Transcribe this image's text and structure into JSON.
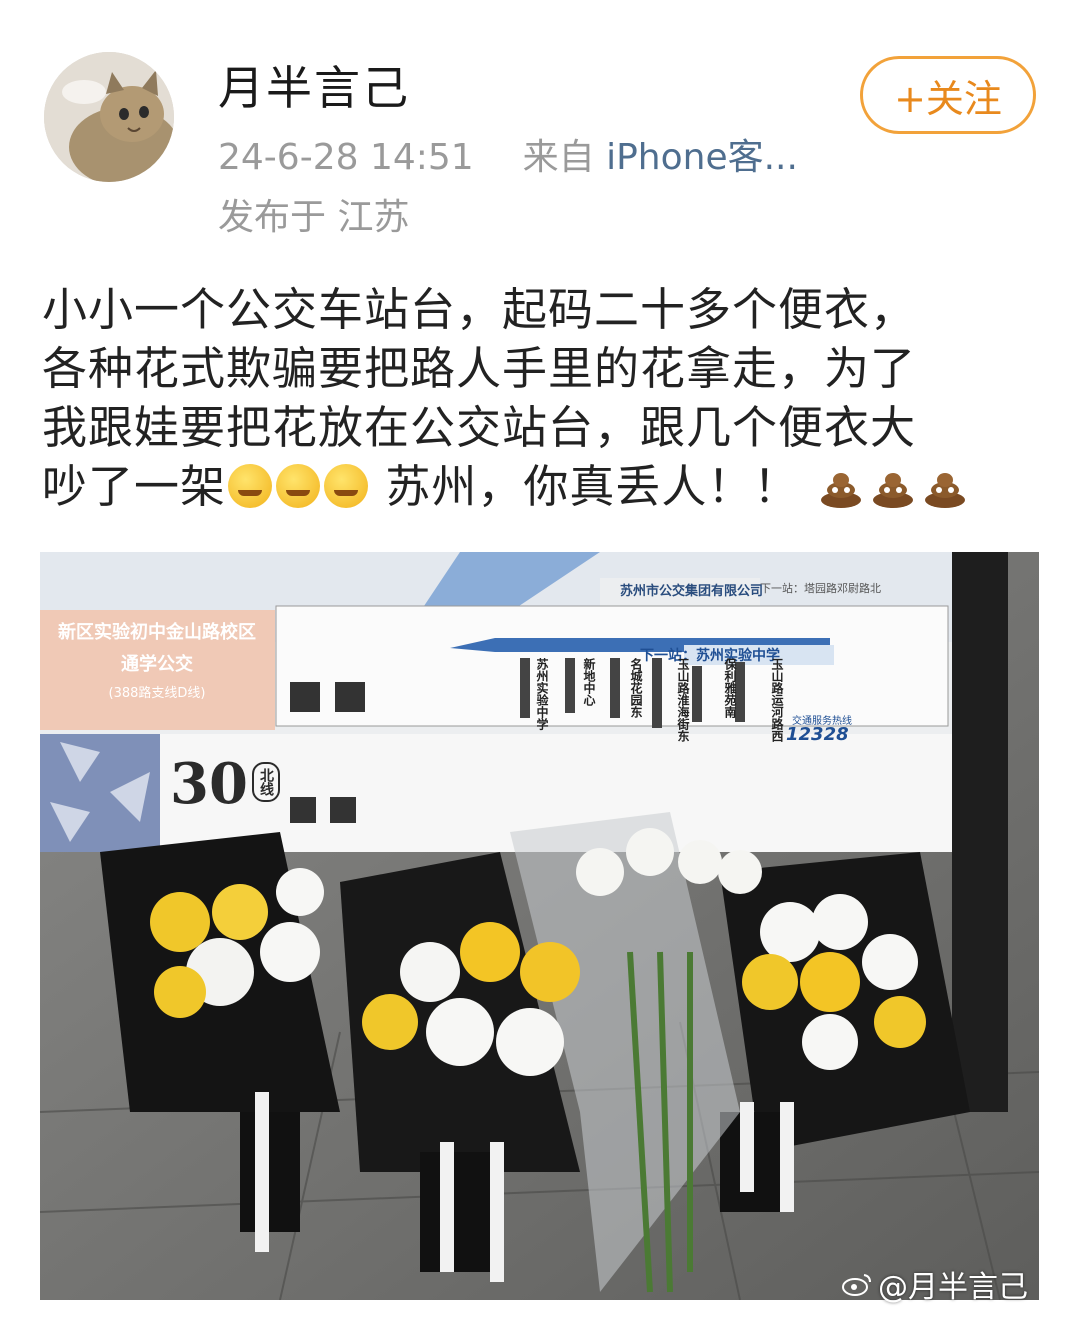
{
  "user": {
    "name": "月半言己",
    "avatar_icon": "cat-avatar-icon"
  },
  "follow": {
    "label": "+关注"
  },
  "meta": {
    "date": "24-6-28 14:51",
    "from_prefix": "来自",
    "client": "iPhone客...",
    "location": "发布于 江苏"
  },
  "post": {
    "lines": [
      "小小一个公交车站台，起码二十多个便衣，",
      "各种花式欺骗要把路人手里的花拿走，为了",
      "我跟娃要把花放在公交站台，跟几个便衣大"
    ],
    "line4_before": "吵了一架",
    "line4_after": " 苏州，你真丢人！！ ",
    "emoji_face": "grimacing-face-emoji",
    "emoji_poop": "poop-emoji"
  },
  "photo": {
    "sign": {
      "company": "苏州市公交集团有限公司",
      "next_stop_top": "下一站：塔园路邓尉路北",
      "route_banner_line1": "新区实验初中金山路校区",
      "route_banner_line2": "通学公交",
      "route_banner_line3": "(388路支线D线)",
      "next_stop": "下一站：苏州实验中学",
      "stops": [
        "苏州实验中学",
        "新地中心",
        "名城花园东",
        "玉山路淮海街东",
        "保利雅苑南",
        "玉山路运河路西"
      ],
      "hotline_label": "交通服务热线",
      "hotline": "12328",
      "route_number": "30",
      "route_suffix": "北线"
    },
    "watermark": "@月半言己"
  },
  "colors": {
    "accent": "#f2a23a",
    "client_link": "#4f6e8f",
    "meta": "#9a9a9a"
  }
}
